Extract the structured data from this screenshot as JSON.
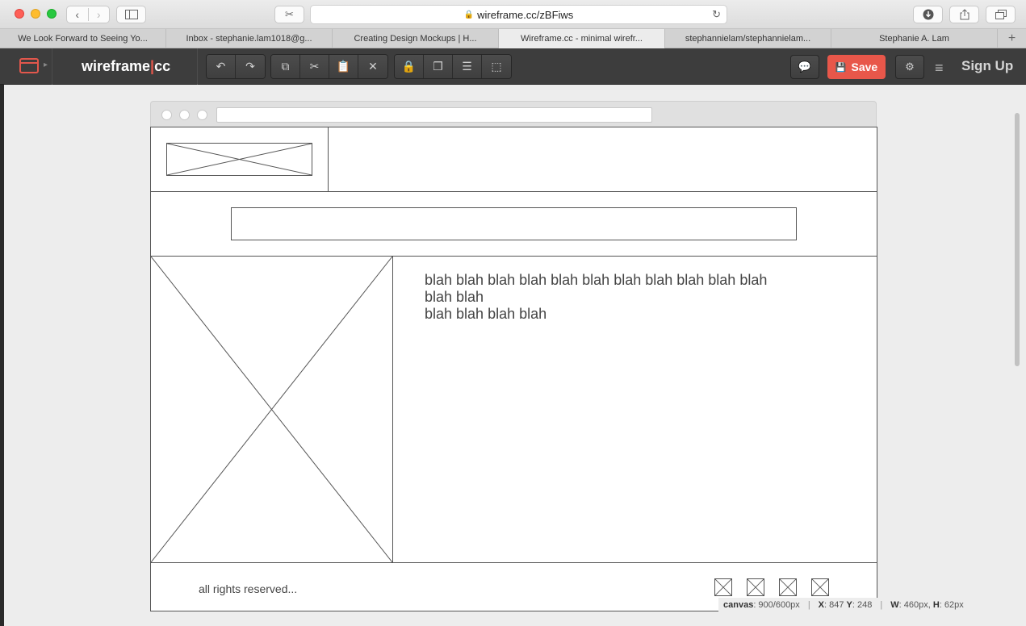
{
  "browser": {
    "url": "wireframe.cc/zBFiws",
    "tabs": [
      {
        "label": "We Look Forward to Seeing Yo...",
        "active": false
      },
      {
        "label": "Inbox - stephanie.lam1018@g...",
        "active": false
      },
      {
        "label": "Creating Design Mockups | H...",
        "active": false
      },
      {
        "label": "Wireframe.cc - minimal wirefr...",
        "active": true
      },
      {
        "label": "stephannielam/stephannielam...",
        "active": false
      },
      {
        "label": "Stephanie A. Lam",
        "active": false
      }
    ],
    "new_tab_label": "+"
  },
  "app": {
    "logo_left": "wireframe",
    "logo_sep": "|",
    "logo_right": "cc",
    "save_label": "Save",
    "signup_label": "Sign Up",
    "accent": "#e8574a"
  },
  "wireframe": {
    "body_text_line1": "blah blah blah blah blah blah blah blah blah blah blah",
    "body_text_line2": "blah blah",
    "body_text_line3": "blah blah blah blah",
    "footer_text": "all rights reserved..."
  },
  "status": {
    "canvas_label": "canvas",
    "canvas_value": ": 900/600px",
    "x_label": "X",
    "x_value": ": 847",
    "y_label": "Y",
    "y_value": ": 248",
    "w_label": "W",
    "w_value": ": 460px, ",
    "h_label": "H",
    "h_value": ": 62px"
  }
}
